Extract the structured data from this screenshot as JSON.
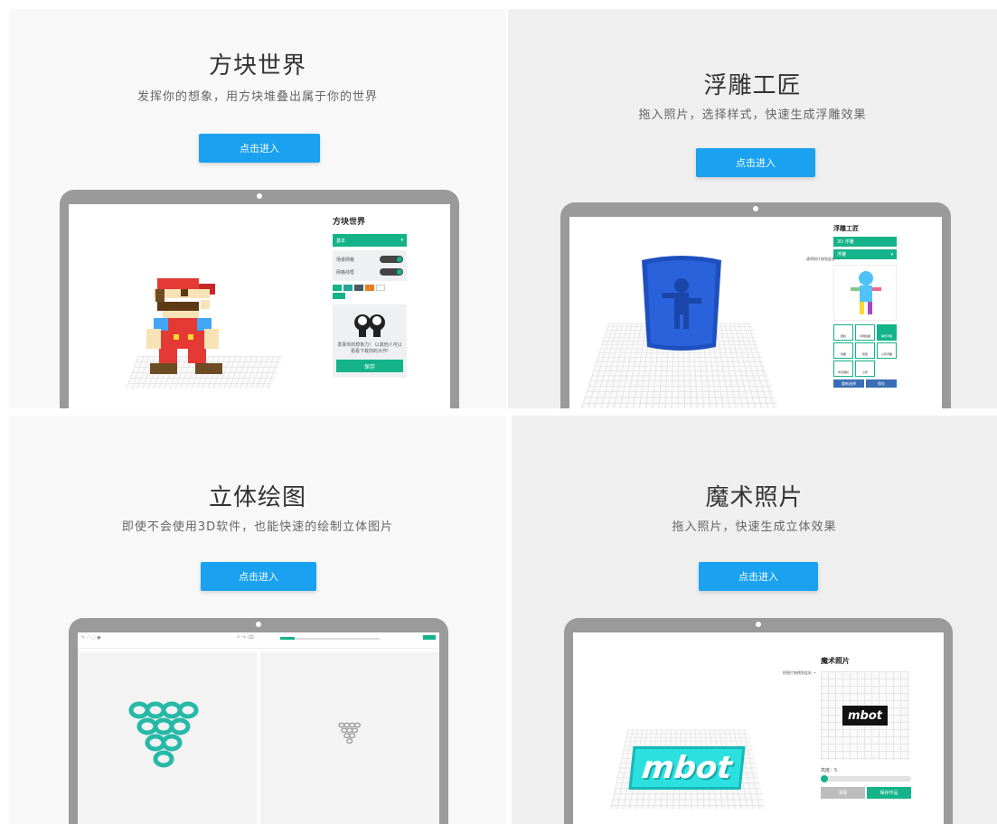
{
  "panels": [
    {
      "title": "方块世界",
      "subtitle": "发挥你的想象，用方块堆叠出属于你的世界",
      "button": "点击进入",
      "app": {
        "title": "方块世界",
        "dropdown": "基本",
        "row1": "场景网格",
        "row2": "网格线框",
        "hint": "发挥你的想象力！ 以其他人可以看看下载你的大作!",
        "save": "保存"
      }
    },
    {
      "title": "浮雕工匠",
      "subtitle": "拖入照片，选择样式，快速生成浮雕效果",
      "button": "点击进入",
      "app": {
        "title": "浮雕工匠",
        "bar1": "3D 浮雕",
        "bar2": "浮雕",
        "label": "请将照片拖到此处 →",
        "styles": [
          "圆柱",
          "半圆柱面",
          "桶形浮雕",
          "球面",
          "框架",
          "心形浮雕",
          "中空圆柱",
          "心形"
        ],
        "btn1": "重新选择",
        "btn2": "保存"
      }
    },
    {
      "title": "立体绘图",
      "subtitle": "即使不会使用3D软件，也能快速的绘制立体图片",
      "button": "点击进入"
    },
    {
      "title": "魔术照片",
      "subtitle": "拖入照片，快速生成立体效果",
      "button": "点击进入",
      "app": {
        "title": "魔术照片",
        "label": "把图片拖拽到此处 →",
        "logo_text": "mbot",
        "height_label": "高度：5",
        "height_value": 5,
        "btn1": "清除",
        "btn2": "保存作品"
      }
    }
  ],
  "colors": {
    "accent_blue": "#1aa1ef",
    "app_green": "#14b38a",
    "laptop_frame": "#9a9a9a"
  }
}
